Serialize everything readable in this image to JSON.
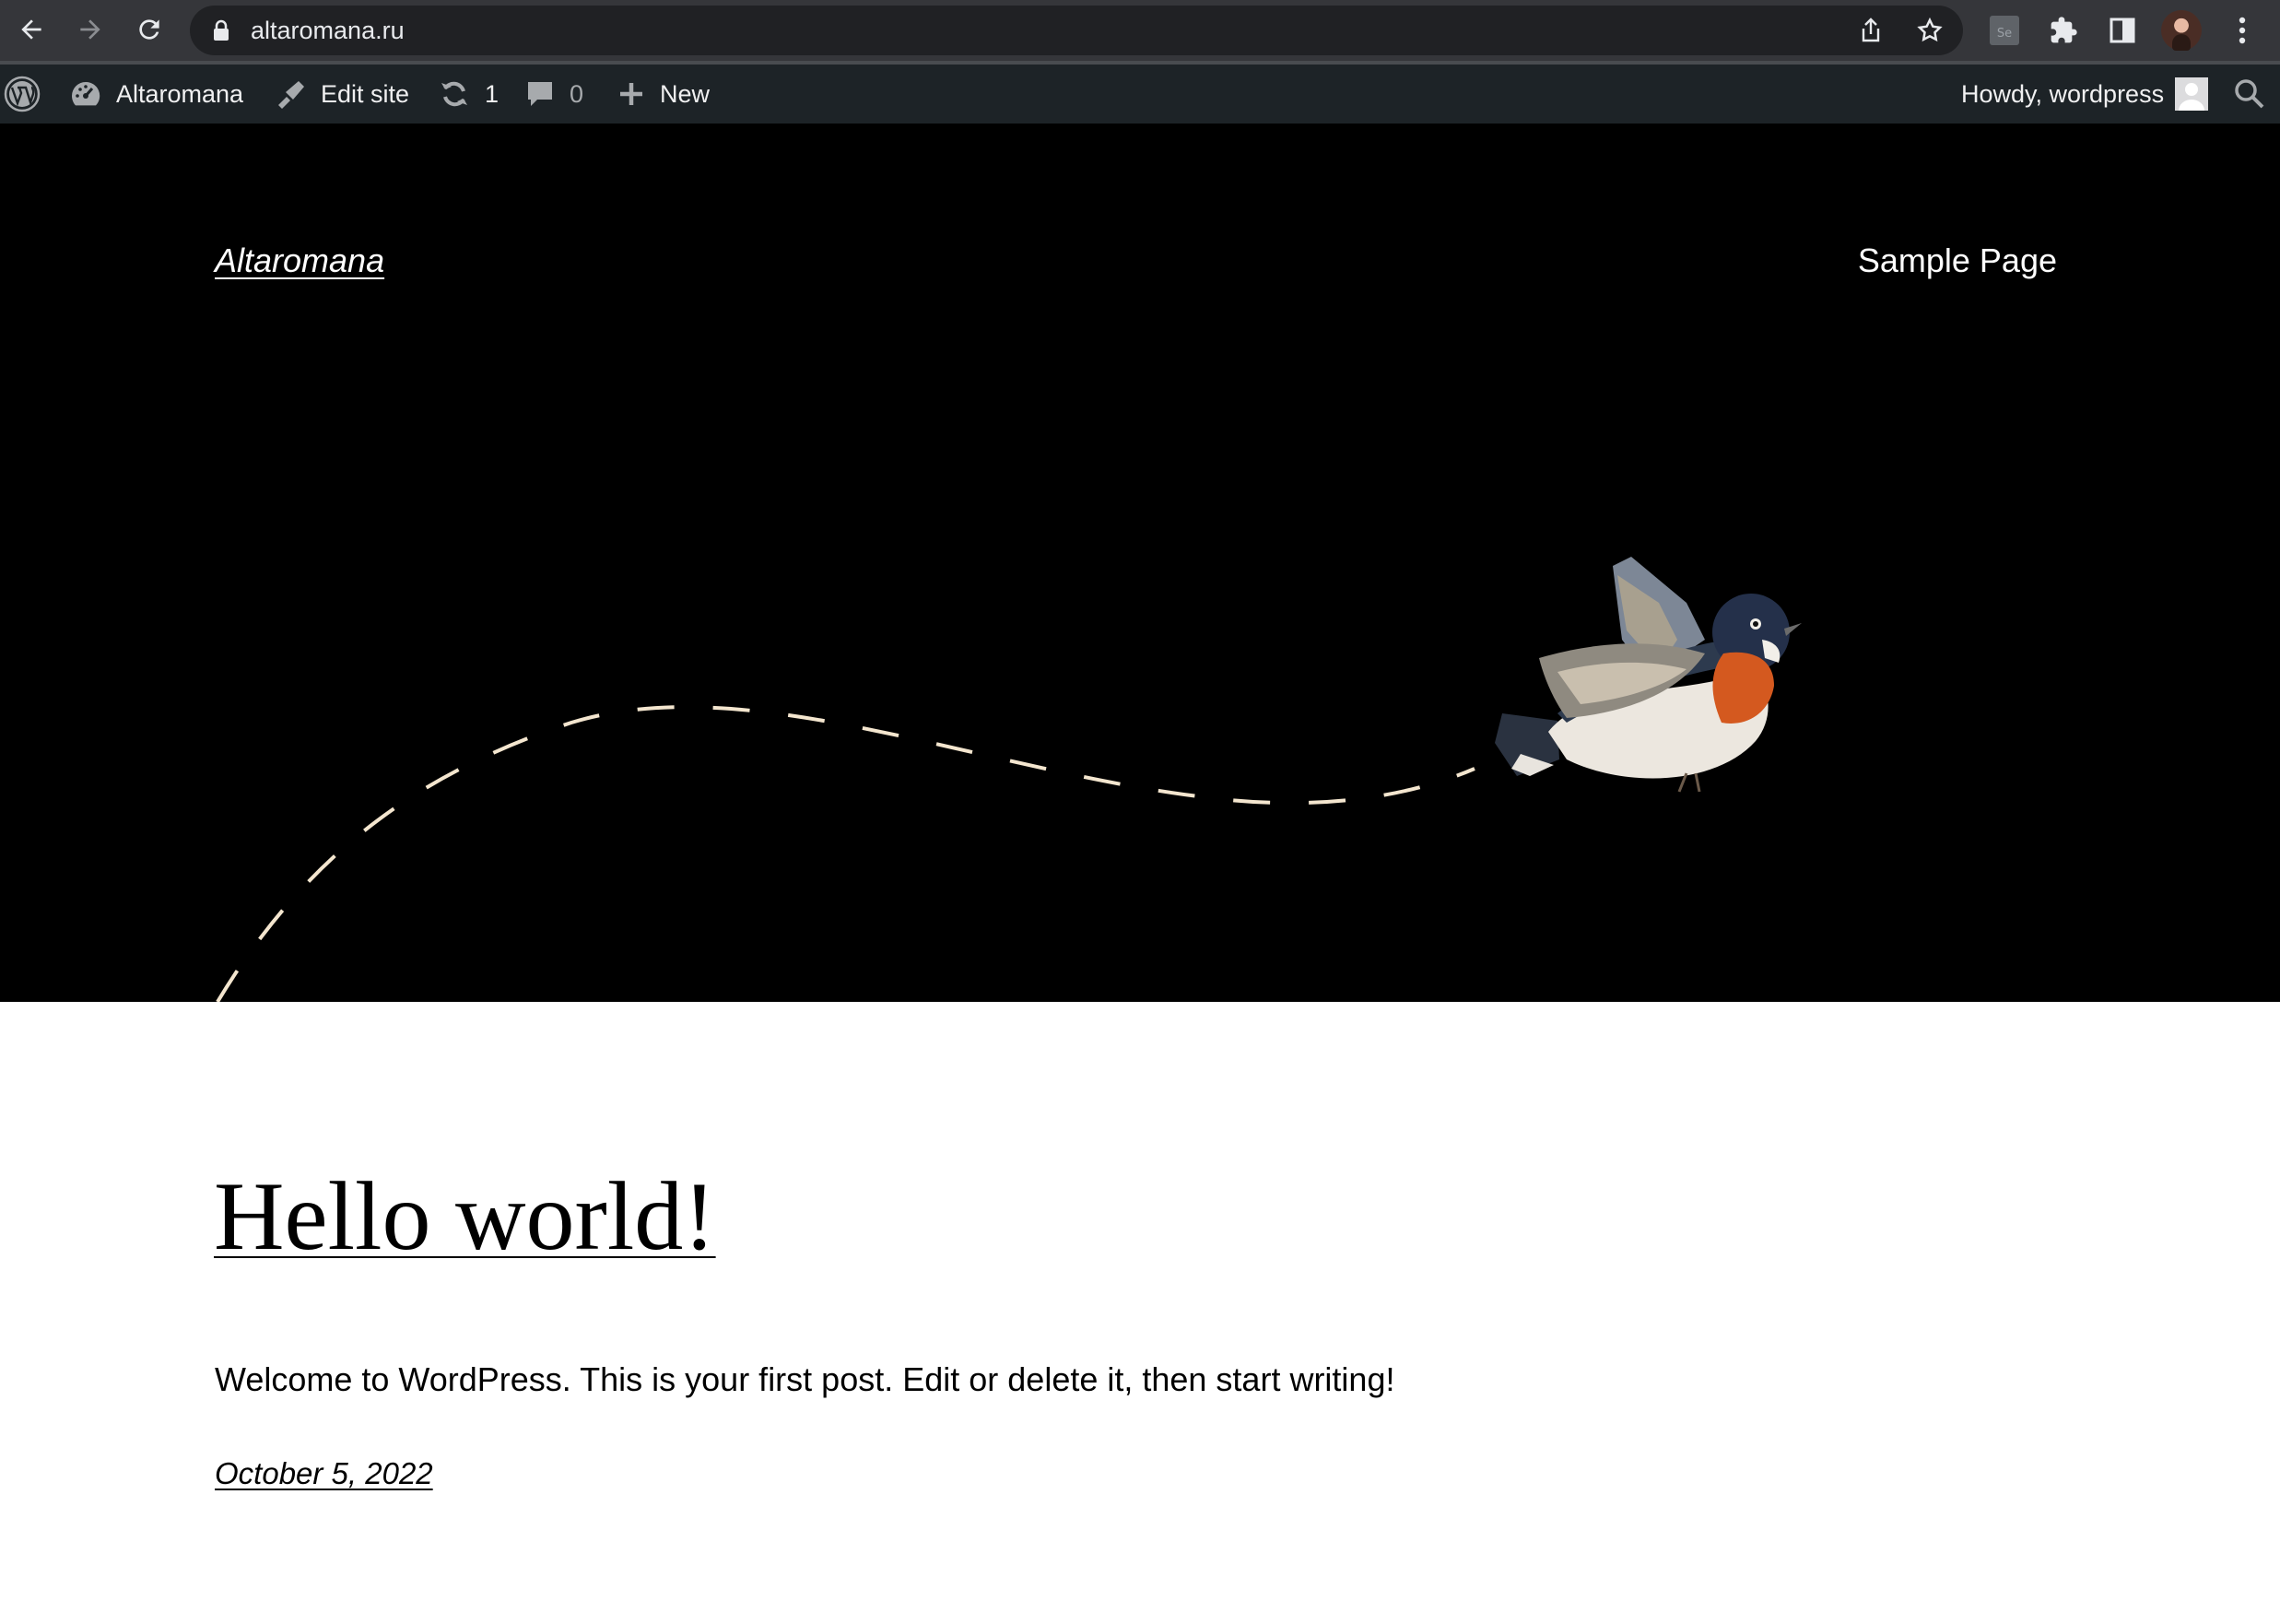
{
  "browser": {
    "url": "altaromana.ru"
  },
  "adminbar": {
    "site_name": "Altaromana",
    "edit_site": "Edit site",
    "updates_count": "1",
    "comments_count": "0",
    "new_label": "New",
    "howdy": "Howdy, wordpress"
  },
  "header": {
    "site_title": "Altaromana",
    "nav_items": [
      "Sample Page"
    ]
  },
  "post": {
    "title": "Hello world!",
    "excerpt": "Welcome to WordPress. This is your first post. Edit or delete it, then start writing!",
    "date": "October 5, 2022"
  },
  "colors": {
    "chrome": "#35363a",
    "adminbar": "#1d2327",
    "hero_bg": "#000000",
    "dash_line": "#f4e6cf"
  }
}
